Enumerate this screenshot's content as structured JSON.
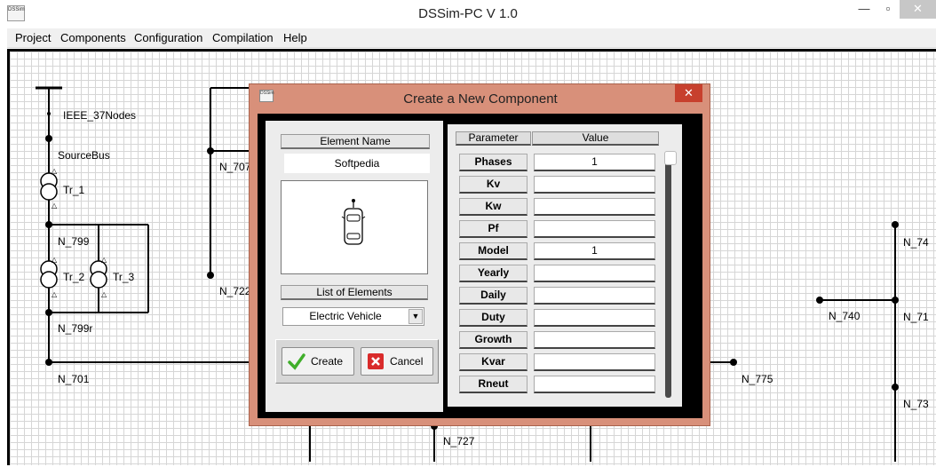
{
  "window": {
    "title": "DSSim-PC V 1.0",
    "icon_text": "DSSim",
    "minimize_glyph": "—",
    "maximize_glyph": "▫",
    "close_glyph": "✕"
  },
  "menu": [
    "Project",
    "Components",
    "Configuration",
    "Compilation",
    "Help"
  ],
  "schematic": {
    "nodes": [
      "IEEE_37Nodes",
      "SourceBus",
      "Tr_1",
      "N_799",
      "Tr_2",
      "Tr_3",
      "N_799r",
      "N_701",
      "N_707",
      "N_722",
      "N_775",
      "N_740",
      "N_727",
      "N_74",
      "N_71",
      "N_73"
    ]
  },
  "dialog": {
    "title": "Create a New Component",
    "icon_text": "DSSim",
    "close_glyph": "✕",
    "element_name_label": "Element Name",
    "element_name_value": "Softpedia",
    "list_label": "List of Elements",
    "selected_element": "Electric Vehicle",
    "create_label": "Create",
    "cancel_label": "Cancel",
    "grid": {
      "parameter_header": "Parameter",
      "value_header": "Value",
      "rows": [
        {
          "name": "Phases",
          "value": "1"
        },
        {
          "name": "Kv",
          "value": ""
        },
        {
          "name": "Kw",
          "value": ""
        },
        {
          "name": "Pf",
          "value": ""
        },
        {
          "name": "Model",
          "value": "1"
        },
        {
          "name": "Yearly",
          "value": ""
        },
        {
          "name": "Daily",
          "value": ""
        },
        {
          "name": "Duty",
          "value": ""
        },
        {
          "name": "Growth",
          "value": ""
        },
        {
          "name": "Kvar",
          "value": ""
        },
        {
          "name": "Rneut",
          "value": ""
        }
      ]
    }
  },
  "colors": {
    "dialog_frame": "#d8907a",
    "close_button": "#c7402d",
    "create_check": "#3fae2a",
    "cancel_x": "#d92b2b"
  }
}
